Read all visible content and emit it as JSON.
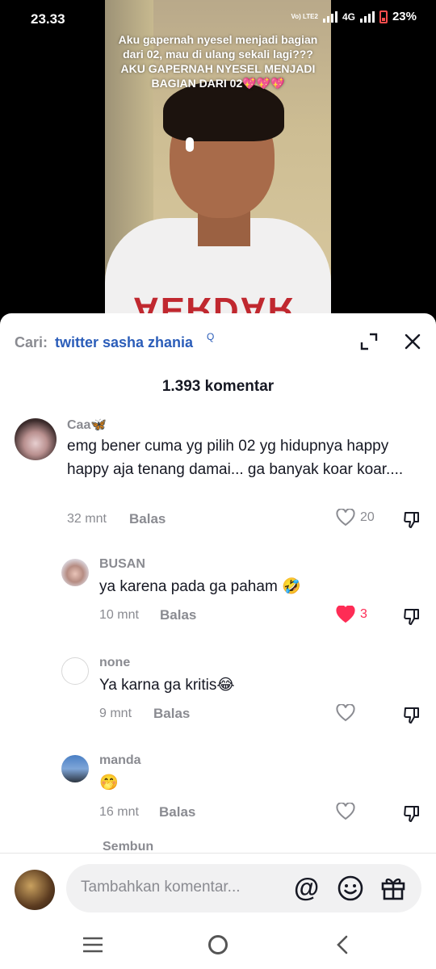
{
  "status": {
    "time": "23.33",
    "volte": "Vo) LTE2",
    "network": "4G",
    "battery": "23%"
  },
  "video": {
    "caption": "Aku gapernah nyesel menjadi bagian dari 02, mau di ulang sekali lagi??? AKU GAPERNAH NYESEL MENJADI BAGIAN DARI 02💖💖💖",
    "shirt_print": "AERDAR"
  },
  "search": {
    "prefix": "Cari:",
    "term": "twitter sasha zhania",
    "glyph": "Q"
  },
  "comment_count": "1.393 komentar",
  "comments": [
    {
      "username": "Caa🦋",
      "text": "emg bener cuma yg pilih 02 yg hidupnya happy happy aja tenang damai... ga banyak koar koar....",
      "time": "32 mnt",
      "reply": "Balas",
      "likes": "20"
    },
    {
      "username": "BUSAN",
      "text": "ya karena pada ga paham 🤣",
      "time": "10 mnt",
      "reply": "Balas",
      "likes": "3"
    },
    {
      "username": "none",
      "text": "Ya karna ga kritis😂",
      "time": "9 mnt",
      "reply": "Balas",
      "likes": ""
    },
    {
      "username": "manda",
      "text": "🤭",
      "time": "16 mnt",
      "reply": "Balas",
      "likes": ""
    }
  ],
  "more_replies": "Sembun",
  "input": {
    "placeholder": "Tambahkan komentar...",
    "at_symbol": "@"
  },
  "colors": {
    "accent_blue": "#2b5db9",
    "like_red": "#fe2c55",
    "muted": "#8a8b91"
  }
}
